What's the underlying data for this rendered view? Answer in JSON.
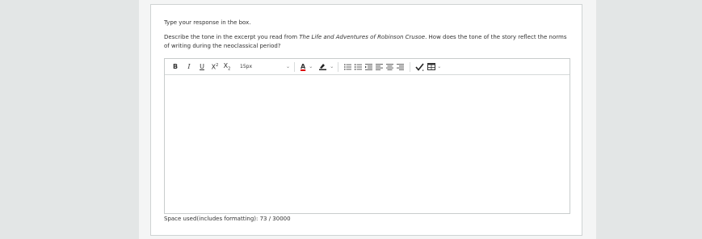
{
  "instruction": "Type your response in the box.",
  "question": {
    "before": "Describe the tone in the excerpt you read from ",
    "title": "The Life and Adventures of Robinson Crusoe",
    "after": ". How does the tone of the story reflect the norms of writing during the neoclassical period?"
  },
  "toolbar": {
    "bold_label": "B",
    "italic_label": "I",
    "underline_label": "U",
    "superscript_base": "X",
    "superscript_mark": "2",
    "subscript_base": "X",
    "subscript_mark": "2",
    "font_size_value": "15px",
    "font_color_label": "A",
    "icons": {
      "bold": "bold-icon",
      "italic": "italic-icon",
      "underline": "underline-icon",
      "font_color": "font-color-icon",
      "highlight": "highlight-pen-icon",
      "bullet_list": "bullet-list-icon",
      "numbered_list": "numbered-list-icon",
      "indent": "indent-icon",
      "align_left": "align-left-icon",
      "align_center": "align-center-icon",
      "align_right": "align-right-icon",
      "spellcheck": "spellcheck-icon",
      "table": "table-icon"
    }
  },
  "editor_content": "",
  "counter": {
    "label": "Space used(includes formatting): 73 / 30000"
  },
  "colors": {
    "page_bg": "#e3e6e6",
    "card_bg": "#ffffff",
    "border": "#cfd3d3",
    "font_color_underline": "#d00000"
  }
}
